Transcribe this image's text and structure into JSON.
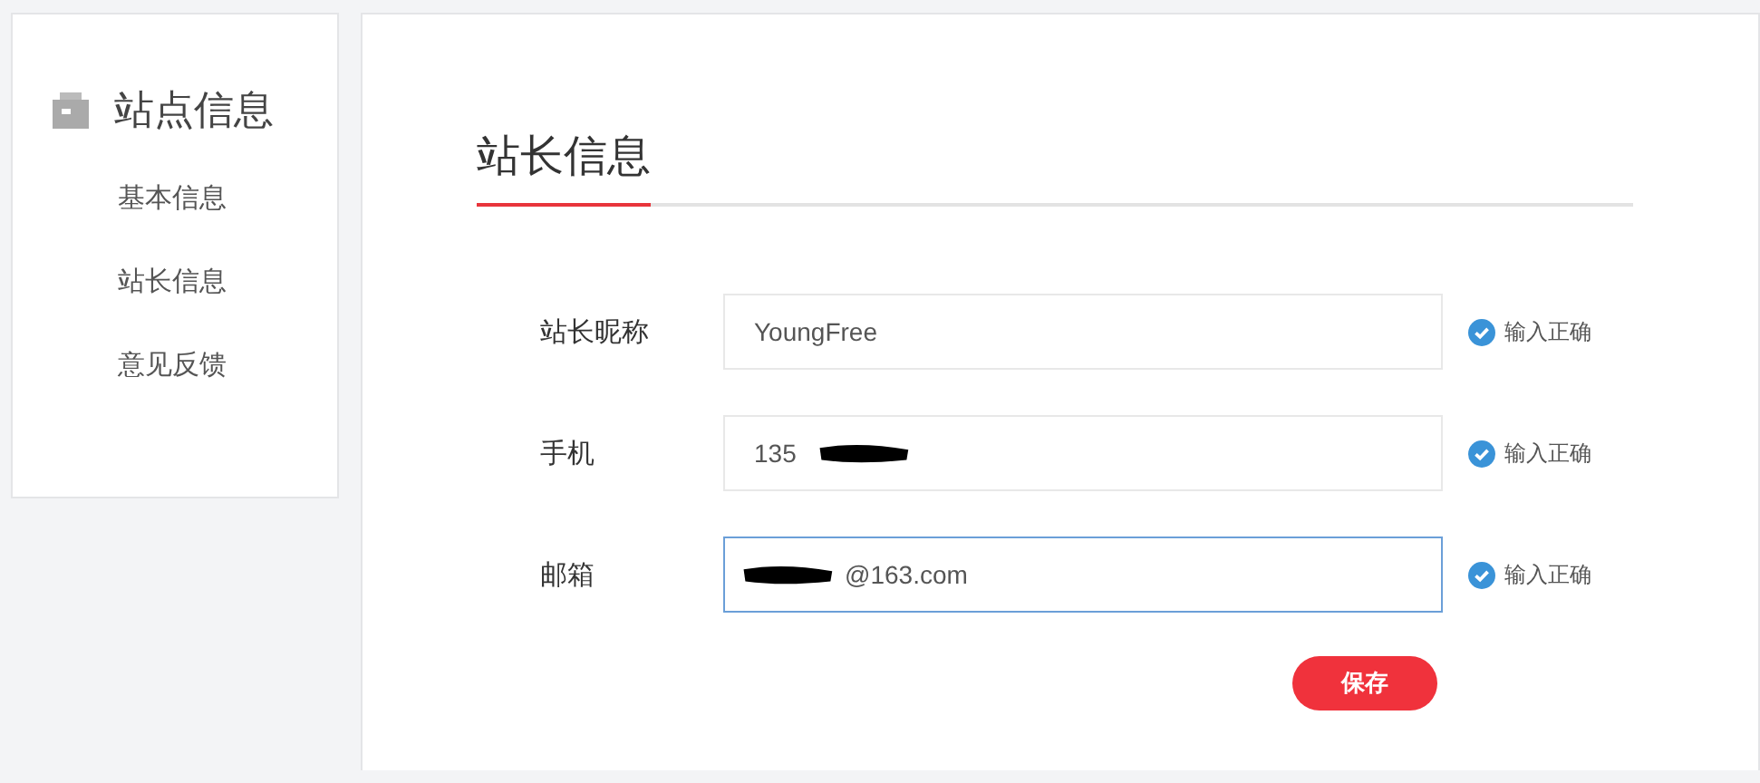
{
  "sidebar": {
    "title": "站点信息",
    "items": [
      {
        "label": "基本信息"
      },
      {
        "label": "站长信息"
      },
      {
        "label": "意见反馈"
      }
    ]
  },
  "main": {
    "title": "站长信息",
    "fields": [
      {
        "label": "站长昵称",
        "value": "YoungFree",
        "valid": true,
        "status": "输入正确",
        "focused": false,
        "redacted_before": false,
        "redacted_after": false
      },
      {
        "label": "手机",
        "value": "135",
        "valid": true,
        "status": "输入正确",
        "focused": false,
        "redacted_before": false,
        "redacted_after": true
      },
      {
        "label": "邮箱",
        "value": "@163.com",
        "valid": true,
        "status": "输入正确",
        "focused": true,
        "redacted_before": true,
        "redacted_after": false
      }
    ],
    "save_button": "保存"
  }
}
